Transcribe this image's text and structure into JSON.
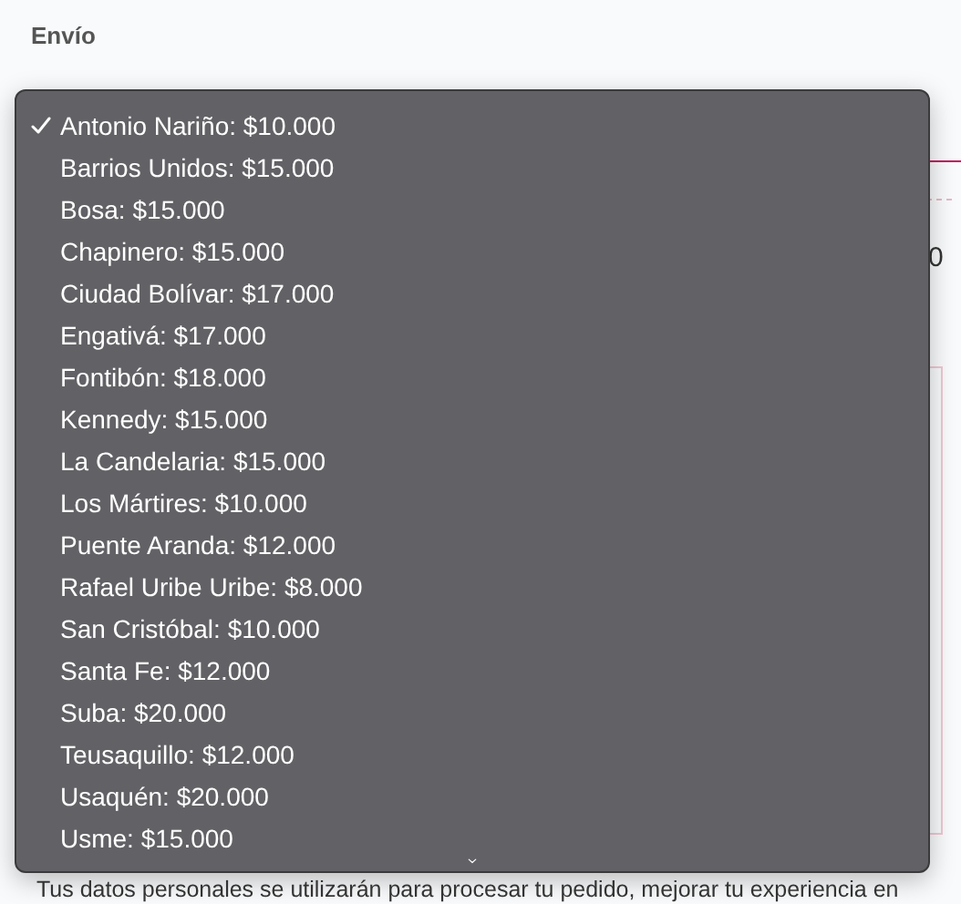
{
  "section_label": "Envío",
  "side_text": "0",
  "dropdown": {
    "options": [
      {
        "label": "Antonio Nariño: $10.000",
        "selected": true
      },
      {
        "label": "Barrios Unidos: $15.000",
        "selected": false
      },
      {
        "label": "Bosa: $15.000",
        "selected": false
      },
      {
        "label": "Chapinero: $15.000",
        "selected": false
      },
      {
        "label": "Ciudad Bolívar: $17.000",
        "selected": false
      },
      {
        "label": "Engativá: $17.000",
        "selected": false
      },
      {
        "label": "Fontibón: $18.000",
        "selected": false
      },
      {
        "label": "Kennedy: $15.000",
        "selected": false
      },
      {
        "label": "La Candelaria: $15.000",
        "selected": false
      },
      {
        "label": "Los Mártires: $10.000",
        "selected": false
      },
      {
        "label": "Puente Aranda: $12.000",
        "selected": false
      },
      {
        "label": "Rafael Uribe Uribe: $8.000",
        "selected": false
      },
      {
        "label": "San Cristóbal: $10.000",
        "selected": false
      },
      {
        "label": "Santa Fe: $12.000",
        "selected": false
      },
      {
        "label": "Suba: $20.000",
        "selected": false
      },
      {
        "label": "Teusaquillo: $12.000",
        "selected": false
      },
      {
        "label": "Usaquén: $20.000",
        "selected": false
      },
      {
        "label": "Usme: $15.000",
        "selected": false
      }
    ]
  },
  "privacy_text": "Tus datos personales se utilizarán para procesar tu pedido, mejorar tu experiencia en"
}
